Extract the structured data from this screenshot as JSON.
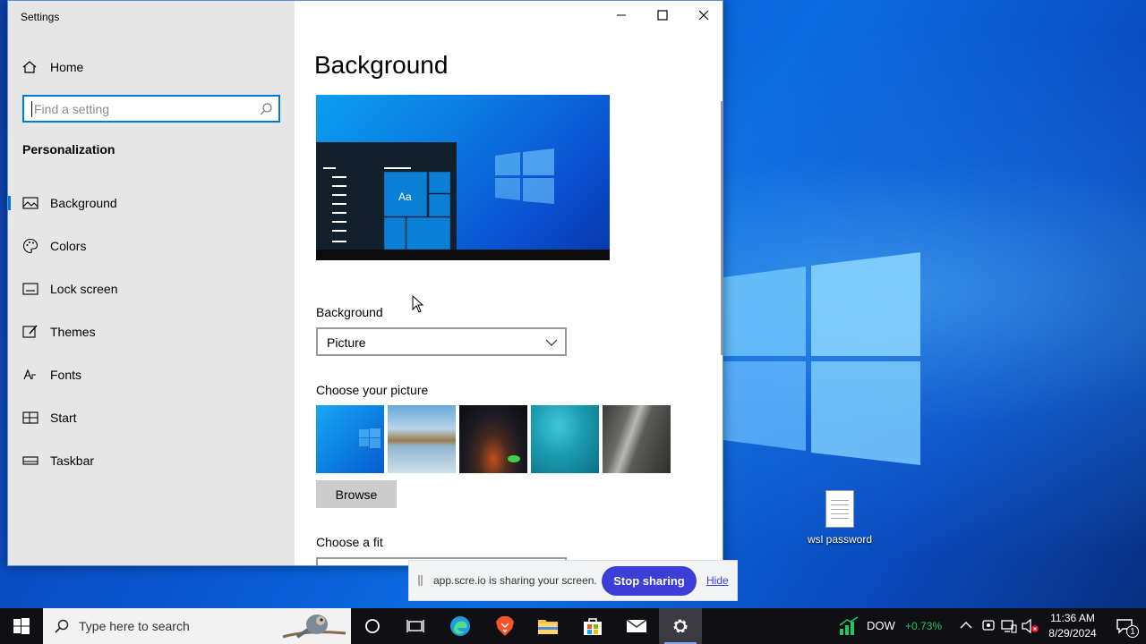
{
  "window": {
    "title": "Settings",
    "controls": {
      "minimize": "minimize",
      "maximize": "maximize",
      "close": "close"
    }
  },
  "sidebar": {
    "home_label": "Home",
    "search_placeholder": "Find a setting",
    "section_title": "Personalization",
    "items": [
      {
        "label": "Background",
        "icon": "picture-icon",
        "active": true
      },
      {
        "label": "Colors",
        "icon": "palette-icon",
        "active": false
      },
      {
        "label": "Lock screen",
        "icon": "lock-screen-icon",
        "active": false
      },
      {
        "label": "Themes",
        "icon": "brush-icon",
        "active": false
      },
      {
        "label": "Fonts",
        "icon": "font-icon",
        "active": false
      },
      {
        "label": "Start",
        "icon": "start-icon",
        "active": false
      },
      {
        "label": "Taskbar",
        "icon": "taskbar-icon",
        "active": false
      }
    ]
  },
  "main": {
    "title": "Background",
    "preview_sample_text": "Aa",
    "background_label": "Background",
    "background_value": "Picture",
    "choose_picture_label": "Choose your picture",
    "browse_label": "Browse",
    "choose_fit_label": "Choose a fit"
  },
  "share_bar": {
    "message": "app.scre.io is sharing your screen.",
    "stop_label": "Stop sharing",
    "hide_label": "Hide"
  },
  "desktop": {
    "icon_label": "wsl password"
  },
  "taskbar": {
    "search_text": "Type here to search",
    "stock_name": "DOW",
    "stock_change": "+0.73%",
    "time": "11:36 AM",
    "date": "8/29/2024",
    "notification_count": "1",
    "colors": {
      "stock_up": "#22c55e",
      "accent": "#0078d7"
    }
  }
}
